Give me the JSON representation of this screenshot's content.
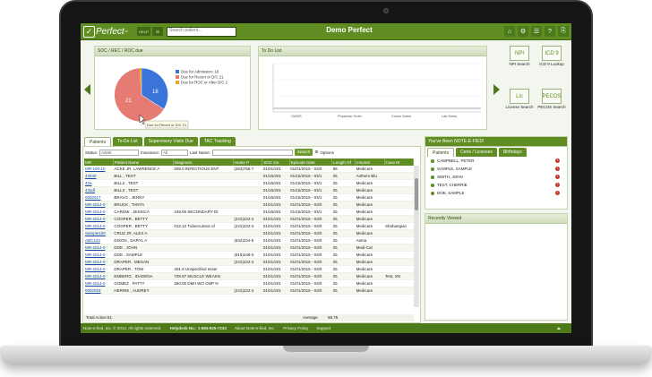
{
  "app": {
    "logo_text": "Perfect",
    "logo_tm": "™",
    "check": "✓",
    "title": "Demo Perfect",
    "search_placeholder": "Search patient..."
  },
  "topbar": {
    "btn1": "HELP",
    "btn2": "✉",
    "icons": [
      "⌂",
      "⚙",
      "☰",
      "?",
      "⎘"
    ]
  },
  "soc_panel": {
    "title": "SOC / REC / ROC due",
    "legend": [
      "Due for Admission: 18",
      "Due for Recert or D/C 21",
      "Due for ROC or After D/C 2"
    ],
    "tooltip": "Due for Recert or D/C 21",
    "label_blue": "18",
    "label_red": "21"
  },
  "todo_panel": {
    "title": "To Do List",
    "axis": [
      "OASIS",
      "Physician Order",
      "Comm Notes",
      "Lab Notes"
    ]
  },
  "quick_links": [
    {
      "icon": "NPI",
      "label": "NPI Search"
    },
    {
      "icon": "ICD 9",
      "label": "ICD 9 Lookup"
    },
    {
      "icon": "Lic",
      "label": "License Search"
    },
    {
      "icon": "PECOS",
      "label": "PECOS Search"
    }
  ],
  "main_tabs": [
    "Patients",
    "To-Do List",
    "Supervisory Visits Due",
    "TAC Tracking"
  ],
  "filters": {
    "status_label": "Status:",
    "status_value": "Admit",
    "insurance_label": "Insurance:",
    "insurance_value": "All",
    "lastname_label": "Last Name:",
    "search_btn": "Search",
    "options_btn": "Options"
  },
  "table": {
    "headers": [
      "MR",
      "Patient Name",
      "Diagnosis",
      "Home P",
      "SOC Da",
      "Episode Date",
      "Length Of",
      "Insuran",
      "Case M"
    ],
    "rows": [
      [
        "MR-100-10",
        "ACKE JR, LAWRENCE A",
        "009.0 INFECTIOUS ENT",
        "(263)756-7",
        "01/01/201",
        "01/01/2015 - 03/0",
        "98",
        "Medicare",
        ""
      ],
      [
        "43540",
        "BILL , TEST",
        "",
        "",
        "01/15/201",
        "01/15/2015 - 03/1",
        "25",
        "Anthem Blu",
        ""
      ],
      [
        "43a",
        "BILL2 , TEST",
        "",
        "",
        "01/15/201",
        "01/15/2015 - 03/1",
        "25",
        "Medicare",
        ""
      ],
      [
        "43sdf",
        "BILL3 , TEST",
        "",
        "",
        "01/15/201",
        "01/15/2015 - 03/1",
        "25",
        "Medicare",
        ""
      ],
      [
        "0002017",
        "BRAVO , JENNY",
        "",
        "",
        "01/15/201",
        "01/15/2015 - 03/1",
        "25",
        "Medicare",
        ""
      ],
      [
        "MR-2014-0",
        "BRUCK , TANYA",
        "",
        "",
        "01/01/201",
        "01/01/2015 - 03/0",
        "25",
        "Medicare",
        ""
      ],
      [
        "MR-2014-0",
        "CARDW , JESSICA",
        "249.00 SECONDARY DI",
        "",
        "01/15/201",
        "01/15/2015 - 03/1",
        "25",
        "Medicare",
        ""
      ],
      [
        "MR-2014-0",
        "COOPER , BETTY",
        "",
        "(222)222-2",
        "01/01/201",
        "01/01/2015 - 03/0",
        "25",
        "Medicare",
        ""
      ],
      [
        "MR-2014-0",
        "COOPER , BETTY",
        "012.12 Tuberculosis of",
        "(222)222-2",
        "01/01/201",
        "01/01/2015 - 03/0",
        "25",
        "Medicare",
        "Shahangian"
      ],
      [
        "Sample100",
        "CRUZ JR, ALEX A",
        "",
        "",
        "01/01/201",
        "01/01/2015 - 03/0",
        "25",
        "Medicare",
        ""
      ],
      [
        "ABC123",
        "DIXON , DARYL A",
        "",
        "(832)234-5",
        "01/01/201",
        "01/01/2015 - 03/0",
        "25",
        "Aetna",
        ""
      ],
      [
        "MR-2014-0",
        "DOE , JOHN",
        "",
        "",
        "01/01/201",
        "01/01/2015 - 03/0",
        "25",
        "Medi-Cal",
        ""
      ],
      [
        "MR-2014-0",
        "DOE , SAMPLE",
        "",
        "(818)449-0",
        "01/01/201",
        "01/01/2015 - 03/0",
        "25",
        "Medicare",
        ""
      ],
      [
        "MR-2014-0",
        "DRAPER , MEGAN",
        "",
        "(222)222-2",
        "01/01/201",
        "01/01/2015 - 03/0",
        "25",
        "Medicare",
        ""
      ],
      [
        "MR-2014-0",
        "DRAPER , TONI",
        "401.9 Unspecified esser",
        "",
        "01/01/201",
        "01/01/2015 - 03/0",
        "25",
        "Medicare",
        ""
      ],
      [
        "MR-2014-0",
        "EMBERG , IDADENA",
        "728.87 MUSCLE WEAKN",
        "",
        "01/01/201",
        "01/01/2015 - 03/0",
        "25",
        "Medicare",
        "Test, SN"
      ],
      [
        "MR-2014-0",
        "GOMEZ , PATTY",
        "250.00 DMII WO CMP N",
        "",
        "01/01/201",
        "01/01/2015 - 03/0",
        "25",
        "Medicare",
        ""
      ],
      [
        "0002018",
        "HERRIE , AUDREY",
        "",
        "(222)222-2",
        "01/01/201",
        "01/01/2015 - 03/0",
        "25",
        "Medicare",
        ""
      ]
    ],
    "footer_total": "Total Active:51",
    "footer_avg_label": "Average",
    "footer_avg_value": "58.76"
  },
  "notefied": {
    "title": "You've Been NOTE-E-FIED!",
    "tabs": [
      "Patients",
      "Certs / Licenses",
      "Birthdays"
    ],
    "items": [
      "CAMPBELL, PETER",
      "SAMPLE, SAMPLE",
      "SMITH, JOHN",
      "TEST, CHERRIE",
      "DOE, SAMPLE"
    ],
    "alert": "!"
  },
  "recent": {
    "title": "Recently Viewed"
  },
  "status": {
    "copyright": "Note-e-fied, Inc. © 2014. All rights reserved.",
    "helpdesk": "Helpdesk No.: 1-855-825-7234",
    "links": [
      "About Note-e-fied, Inc.",
      "Privacy Policy",
      "Support"
    ]
  },
  "colors": {
    "accent": "#5f8d22",
    "pie_blue": "#3a74d9",
    "pie_red": "#e57b73",
    "pie_yellow": "#e4a72a"
  }
}
